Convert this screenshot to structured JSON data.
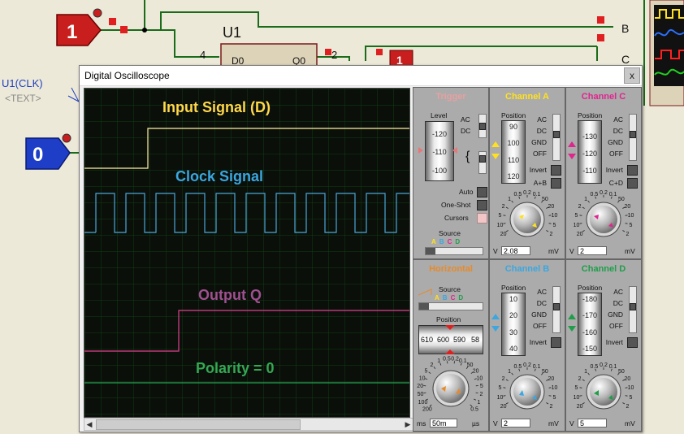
{
  "window": {
    "title": "Digital Oscilloscope",
    "close_label": "x"
  },
  "schematic": {
    "input_d_value": "1",
    "clock_value": "0",
    "chip_name": "U1",
    "pin_d0": "D0",
    "pin_q0": "Q0",
    "pin4": "4",
    "pin2": "2",
    "gate_value": "1",
    "clk_label": "U1(CLK)",
    "text_label": "<TEXT>",
    "right_b": "B",
    "right_c": "C"
  },
  "traces": {
    "input": "Input Signal (D)",
    "clock": "Clock Signal",
    "output": "Output Q",
    "polarity": "Polarity = 0"
  },
  "colors": {
    "channel_a": "#ffe11f",
    "channel_b": "#3aa7e0",
    "channel_c": "#e0258f",
    "channel_d": "#1f9e4a",
    "trigger": "#e87878",
    "horizontal": "#e88a28"
  },
  "trigger": {
    "title": "Trigger",
    "level_label": "Level",
    "drum": [
      "-120",
      "-110",
      "-100"
    ],
    "ac": "AC",
    "dc": "DC",
    "auto": "Auto",
    "oneshot": "One-Shot",
    "cursors": "Cursors",
    "source_label": "Source",
    "sources": [
      "A",
      "B",
      "C",
      "D"
    ]
  },
  "channel_a": {
    "title": "Channel A",
    "position_label": "Position",
    "drum": [
      "90",
      "100",
      "110",
      "120"
    ],
    "ac": "AC",
    "dc": "DC",
    "gnd": "GND",
    "off": "OFF",
    "invert": "Invert",
    "combine": "A+B",
    "scale": [
      "20",
      "10",
      "5",
      "2",
      "1",
      "0.5",
      "0.2",
      "0.1",
      "50",
      "20",
      "10",
      "5",
      "2"
    ],
    "unit_left": "V",
    "unit_right": "mV",
    "value": "2.08"
  },
  "channel_c": {
    "title": "Channel C",
    "position_label": "Position",
    "drum": [
      "-130",
      "-120",
      "-110"
    ],
    "ac": "AC",
    "dc": "DC",
    "gnd": "GND",
    "off": "OFF",
    "invert": "Invert",
    "combine": "C+D",
    "scale": [
      "20",
      "10",
      "5",
      "2",
      "1",
      "0.5",
      "0.2",
      "0.1",
      "50",
      "20",
      "10",
      "5",
      "2"
    ],
    "unit_left": "V",
    "unit_right": "mV",
    "value": "2"
  },
  "horizontal": {
    "title": "Horizontal",
    "source_label": "Source",
    "sources": [
      "A",
      "B",
      "C",
      "D"
    ],
    "position_label": "Position",
    "ruler": [
      "610",
      "600",
      "590",
      "58"
    ],
    "scale": [
      "200",
      "100",
      "50",
      "20",
      "10",
      "5",
      "2",
      "1",
      "0.5",
      "0.2",
      "0.1",
      "50",
      "20",
      "10",
      "5",
      "2",
      "1",
      "0.5"
    ],
    "unit_left": "ms",
    "unit_right": "µs",
    "value": "50m"
  },
  "channel_b": {
    "title": "Channel B",
    "position_label": "Position",
    "drum": [
      "10",
      "20",
      "30",
      "40"
    ],
    "ac": "AC",
    "dc": "DC",
    "gnd": "GND",
    "off": "OFF",
    "invert": "Invert",
    "scale": [
      "20",
      "10",
      "5",
      "2",
      "1",
      "0.5",
      "0.2",
      "0.1",
      "50",
      "20",
      "10",
      "5",
      "2"
    ],
    "unit_left": "V",
    "unit_right": "mV",
    "value": "2"
  },
  "channel_d": {
    "title": "Channel D",
    "position_label": "Position",
    "drum": [
      "-180",
      "-170",
      "-160",
      "-150"
    ],
    "ac": "AC",
    "dc": "DC",
    "gnd": "GND",
    "off": "OFF",
    "invert": "Invert",
    "scale": [
      "20",
      "10",
      "5",
      "2",
      "1",
      "0.5",
      "0.2",
      "0.1",
      "50",
      "20",
      "10",
      "5",
      "2"
    ],
    "unit_left": "V",
    "unit_right": "mV",
    "value": "5"
  }
}
